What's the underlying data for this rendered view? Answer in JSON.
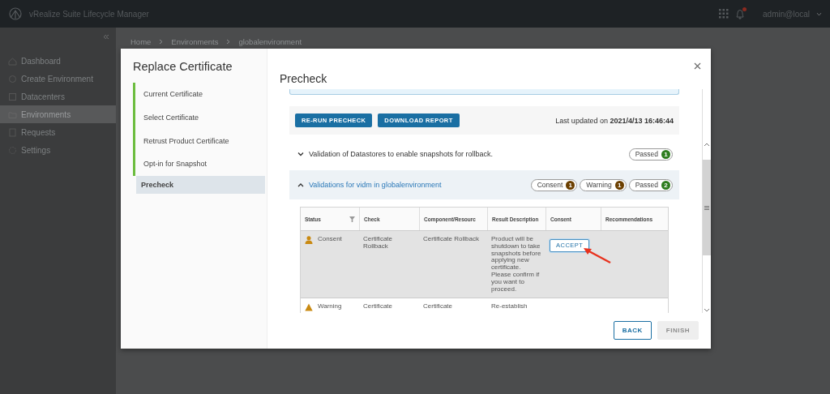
{
  "app_header": {
    "title": "vRealize Suite Lifecycle Manager",
    "user": "admin@local",
    "notification_badge": true
  },
  "sidebar": {
    "items": [
      {
        "label": "Dashboard",
        "selected": false
      },
      {
        "label": "Create Environment",
        "selected": false
      },
      {
        "label": "Datacenters",
        "selected": false
      },
      {
        "label": "Environments",
        "selected": true
      },
      {
        "label": "Requests",
        "selected": false
      },
      {
        "label": "Settings",
        "selected": false
      }
    ]
  },
  "breadcrumb": [
    "Home",
    "Environments",
    "globalenvironment"
  ],
  "modal": {
    "title": "Replace Certificate",
    "steps": [
      {
        "label": "Current Certificate",
        "completed": true,
        "selected": false
      },
      {
        "label": "Select Certificate",
        "completed": true,
        "selected": false
      },
      {
        "label": "Retrust Product Certificate",
        "completed": true,
        "selected": false
      },
      {
        "label": "Opt-in for Snapshot",
        "completed": true,
        "selected": false
      },
      {
        "label": "Precheck",
        "completed": false,
        "selected": true
      }
    ],
    "heading": "Precheck",
    "actions": [
      "RE-RUN PRECHECK",
      "DOWNLOAD REPORT"
    ],
    "last_updated": "Last updated on **2021/4/13 16:46:44**",
    "sections": [
      {
        "title": "Validation of Datastores to enable snapshots for rollback.",
        "expanded": false,
        "badges": [
          {
            "label": "Passed",
            "count": "1",
            "color": "#2e7d1f"
          }
        ]
      },
      {
        "title": "Validations for vidm in globalenvironment",
        "expanded": true,
        "badges": [
          {
            "label": "Consent",
            "count": "1",
            "color": "#6b3f00"
          },
          {
            "label": "Warning",
            "count": "1",
            "color": "#6b3f00"
          },
          {
            "label": "Passed",
            "count": "2",
            "color": "#2e7d1f"
          }
        ],
        "table": {
          "columns": [
            "Status",
            "Check",
            "Component/Resourc",
            "Result Description",
            "Consent",
            "Recommendations"
          ],
          "rows": [
            {
              "kind": "consent",
              "selected": true,
              "status": "Consent",
              "check": "Certificate Rollback",
              "component": "Certificate Rollback",
              "result": "Product will be shutdown to take snapshots before applying new certificate. Please confirm if you want to proceed.",
              "action": "ACCEPT"
            },
            {
              "kind": "warning",
              "selected": false,
              "status": "Warning",
              "check": "Certificate",
              "component": "Certificate",
              "result": "Re-establish"
            }
          ]
        }
      }
    ],
    "footer_buttons": [
      {
        "label": "BACK",
        "disabled": false
      },
      {
        "label": "FINISH",
        "disabled": true
      }
    ]
  }
}
